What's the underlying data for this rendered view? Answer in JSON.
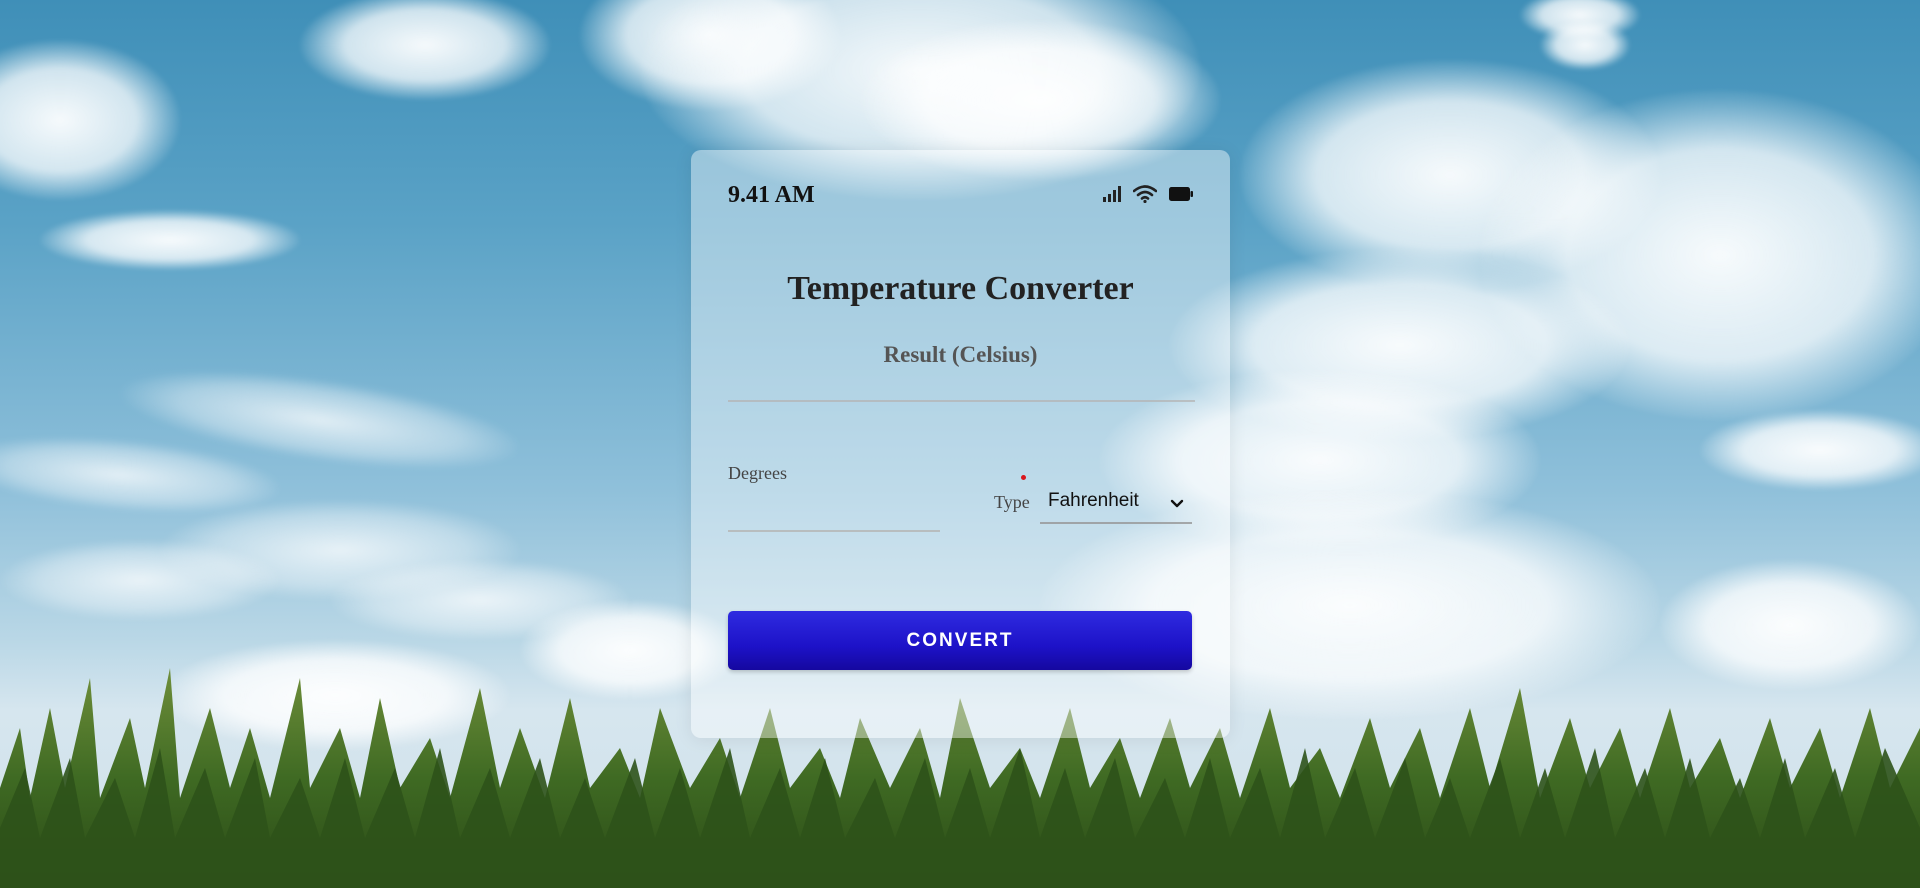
{
  "status": {
    "time": "9.41 AM",
    "icons": [
      "signal-icon",
      "wifi-icon",
      "battery-icon"
    ]
  },
  "app": {
    "title": "Temperature Converter",
    "result_label": "Result (Celsius)",
    "result_value": ""
  },
  "form": {
    "degrees_label": "Degrees",
    "degrees_value": "",
    "type_label": "Type",
    "type_selected": "Fahrenheit"
  },
  "actions": {
    "convert_label": "CONVERT"
  },
  "colors": {
    "button": "#1d12c8",
    "required_marker": "#d9161c",
    "sky": "#4a98c0"
  }
}
